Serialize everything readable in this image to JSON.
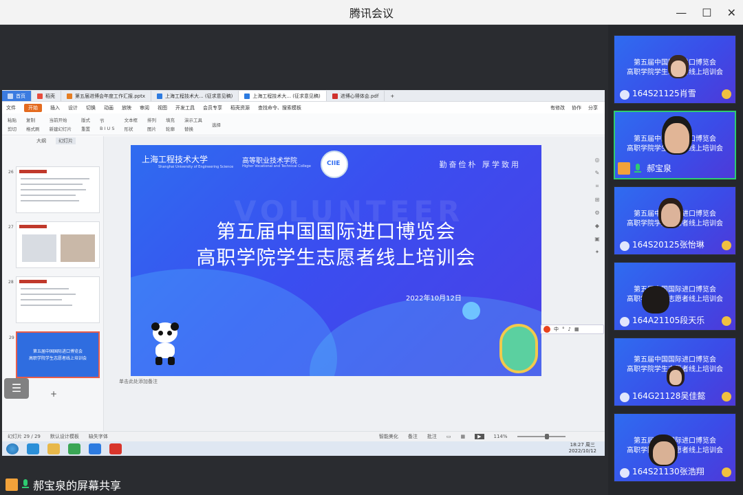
{
  "window": {
    "title": "腾讯会议"
  },
  "share": {
    "label": "郝宝泉的屏幕共享"
  },
  "wps": {
    "tabs": [
      {
        "label": "首页",
        "kind": "home"
      },
      {
        "label": "稻壳",
        "kind": "docer"
      },
      {
        "label": "第五届进博会年度工作汇报.pptx",
        "kind": "ppt"
      },
      {
        "label": "上海工程技术大... (征求意见稿)",
        "kind": "doc"
      },
      {
        "label": "上海工程技术大... (征求意见稿)",
        "kind": "doc-active"
      },
      {
        "label": "进博心得体会.pdf",
        "kind": "pdf"
      }
    ],
    "menu": [
      "文件",
      "开始",
      "插入",
      "设计",
      "切换",
      "动画",
      "放映",
      "审阅",
      "视图",
      "开发工具",
      "会员专享",
      "稻壳资源",
      "查找命令、搜索模板"
    ],
    "menu_active": "开始",
    "menu_right": [
      "有修改",
      "协作",
      "分享"
    ],
    "ribbon": [
      [
        "粘贴",
        "剪切",
        "复制",
        "格式刷"
      ],
      [
        "当前开始",
        "新建幻灯片",
        "版式"
      ],
      [
        "重置",
        "节"
      ],
      [
        "文本框",
        "形状",
        "排列"
      ],
      [
        "图片",
        "填充",
        "轮廓"
      ],
      [
        "演示工具",
        "替换",
        "选择"
      ]
    ],
    "panel_tabs": [
      "大纲",
      "幻灯片"
    ],
    "thumb_numbers": [
      "26",
      "27",
      "28",
      "29"
    ],
    "thumb_sel_lines": [
      "第五届中国国际进口博览会",
      "高职学院学生志愿者线上培训会"
    ],
    "notes_placeholder": "单击此处添加备注",
    "status": {
      "slide": "幻灯片 29 / 29",
      "theme": "默认设计模板",
      "font": "缺失字体",
      "beautify": "智能美化",
      "notes": "备注",
      "comments": "批注",
      "zoom": "114%"
    },
    "clock": {
      "time": "18:27 周三",
      "date": "2022/10/12"
    }
  },
  "slide": {
    "university": "上海工程技术大学",
    "university_en": "Shanghai University of Engineering Science",
    "college": "高等职业技术学院",
    "college_en": "Higher Vocational and Technical College",
    "motto": "勤奋俭朴  厚学致用",
    "watermark": "VOLUNTEER",
    "title_line1": "第五届中国国际进口博览会",
    "title_line2": "高职学院学生志愿者线上培训会",
    "date": "2022年10月12日",
    "badge": "CIIE"
  },
  "participants": [
    {
      "name": "164S21125肖雪",
      "line1": "第五届中国国际进口博览会",
      "line2": "高职学院学生志愿者线上培训会",
      "speaking": false
    },
    {
      "name": "郝宝泉",
      "line1": "第五届中国国际进口博览会",
      "line2": "高职学院学生志愿者线上培训会",
      "speaking": true
    },
    {
      "name": "164S20125张怡琳",
      "line1": "第五届中国国际进口博览会",
      "line2": "高职学院学生志愿者线上培训会",
      "speaking": false
    },
    {
      "name": "164A21105段天乐",
      "line1": "第五届中国国际进口博览会",
      "line2": "高职学院学生志愿者线上培训会",
      "speaking": false
    },
    {
      "name": "164G21128吴佳懿",
      "line1": "第五届中国国际进口博览会",
      "line2": "高职学院学生志愿者线上培训会",
      "speaking": false
    },
    {
      "name": "164S21130张浩翔",
      "line1": "第五届中国国际进口博览会",
      "line2": "高职学院学生志愿者线上培训会",
      "speaking": false
    }
  ],
  "colors": {
    "accent": "#3b7be0",
    "slide_blue": "#2f6cf0",
    "wps_orange": "#e46b1f",
    "speaking": "#2ecc71"
  }
}
